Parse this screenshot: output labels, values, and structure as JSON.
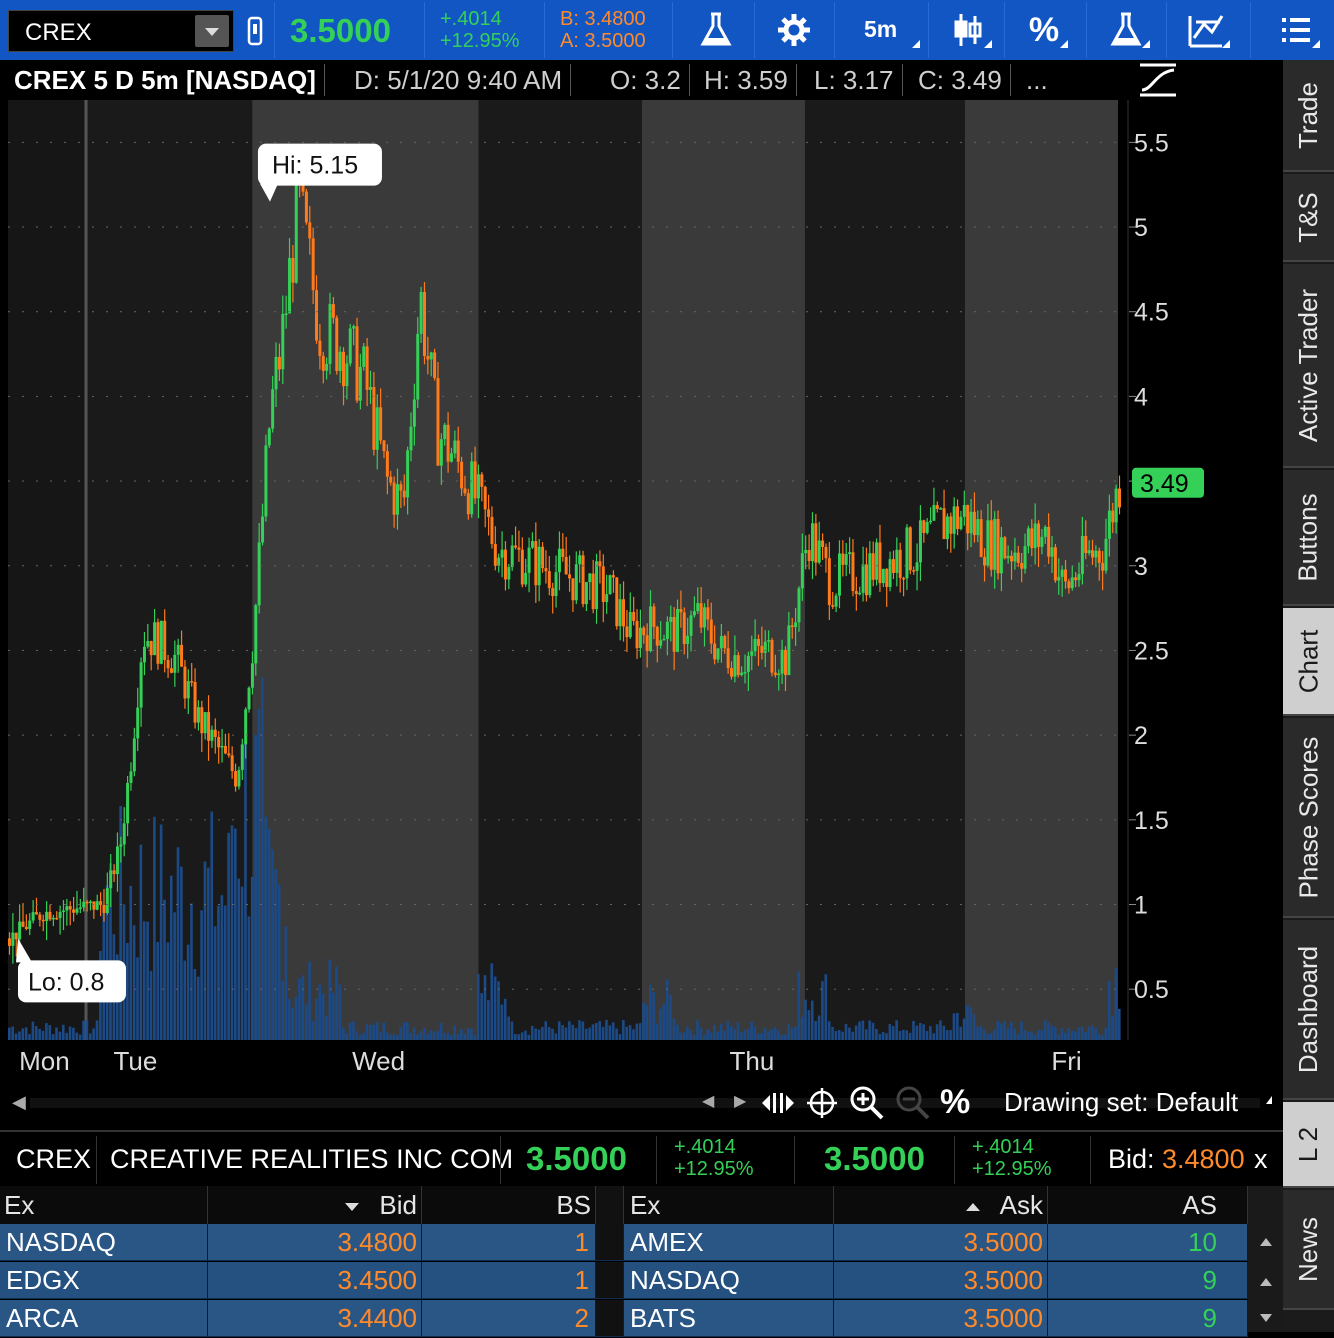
{
  "toolbar": {
    "symbol": "CREX",
    "last": "3.5000",
    "net_change": "+.4014",
    "pct_change": "+12.95%",
    "bid": "B: 3.4800",
    "ask": "A: 3.5000",
    "timeframe": "5m",
    "percent_glyph": "%"
  },
  "chart_header": {
    "title": "CREX 5 D 5m [NASDAQ]",
    "date": "D: 5/1/20 9:40 AM",
    "open": "O: 3.2",
    "high": "H: 3.59",
    "low": "L: 3.17",
    "close": "C: 3.49",
    "more": "..."
  },
  "chart_data": {
    "type": "candlestick",
    "symbol": "CREX",
    "period": "5 D",
    "interval": "5m",
    "ylim": [
      0.2,
      5.75
    ],
    "y_ticks": [
      "0.5",
      "1",
      "1.5",
      "2",
      "2.5",
      "3",
      "3.5",
      "4",
      "4.5",
      "5",
      "5.5"
    ],
    "x_labels": [
      "Mon",
      "Tue",
      "Wed",
      "Thu",
      "Fri"
    ],
    "current_price_label": "3.49",
    "hi_callout": "Hi: 5.15",
    "lo_callout": "Lo: 0.8",
    "hi": 5.15,
    "lo": 0.8,
    "price_path": [
      [
        0.01,
        0.85
      ],
      [
        0.03,
        0.95
      ],
      [
        0.06,
        0.98
      ],
      [
        0.085,
        1.0
      ],
      [
        0.1,
        1.35
      ],
      [
        0.11,
        1.9
      ],
      [
        0.12,
        2.6
      ],
      [
        0.135,
        2.55
      ],
      [
        0.15,
        2.45
      ],
      [
        0.17,
        2.1
      ],
      [
        0.19,
        1.9
      ],
      [
        0.205,
        1.75
      ],
      [
        0.22,
        2.6
      ],
      [
        0.235,
        3.9
      ],
      [
        0.245,
        4.3
      ],
      [
        0.26,
        5.15
      ],
      [
        0.28,
        4.4
      ],
      [
        0.3,
        4.3
      ],
      [
        0.32,
        4.1
      ],
      [
        0.34,
        3.5
      ],
      [
        0.355,
        3.35
      ],
      [
        0.37,
        4.6
      ],
      [
        0.385,
        3.8
      ],
      [
        0.4,
        3.65
      ],
      [
        0.42,
        3.4
      ],
      [
        0.44,
        3.1
      ],
      [
        0.46,
        3.05
      ],
      [
        0.48,
        3.0
      ],
      [
        0.5,
        2.95
      ],
      [
        0.52,
        2.9
      ],
      [
        0.54,
        2.85
      ],
      [
        0.56,
        2.6
      ],
      [
        0.58,
        2.65
      ],
      [
        0.6,
        2.6
      ],
      [
        0.62,
        2.7
      ],
      [
        0.64,
        2.5
      ],
      [
        0.66,
        2.45
      ],
      [
        0.68,
        2.5
      ],
      [
        0.7,
        2.45
      ],
      [
        0.72,
        3.2
      ],
      [
        0.74,
        2.9
      ],
      [
        0.76,
        2.95
      ],
      [
        0.78,
        3.0
      ],
      [
        0.8,
        3.05
      ],
      [
        0.82,
        3.1
      ],
      [
        0.84,
        3.25
      ],
      [
        0.86,
        3.3
      ],
      [
        0.88,
        3.15
      ],
      [
        0.9,
        3.1
      ],
      [
        0.92,
        3.12
      ],
      [
        0.935,
        3.2
      ],
      [
        0.95,
        2.85
      ],
      [
        0.97,
        3.05
      ],
      [
        0.985,
        3.1
      ],
      [
        1.0,
        3.5
      ]
    ]
  },
  "chart_footer": {
    "drawing_set": "Drawing set: Default",
    "percent": "%"
  },
  "right_tabs": [
    "Trade",
    "T&S",
    "Active Trader",
    "Buttons",
    "Chart",
    "Phase Scores",
    "Dashboard",
    "L 2",
    "News"
  ],
  "l2": {
    "symbol": "CREX",
    "name": "CREATIVE REALITIES INC COM",
    "last1": "3.5000",
    "chg1": "+.4014",
    "pct1": "+12.95%",
    "last2": "3.5000",
    "chg2": "+.4014",
    "pct2": "+12.95%",
    "bid_label": "Bid:",
    "bid_value": "3.4800",
    "bid_x": "x",
    "columns": {
      "ex": "Ex",
      "bid": "Bid",
      "bs": "BS",
      "ex2": "Ex",
      "ask": "Ask",
      "as": "AS"
    },
    "bids": [
      {
        "ex": "NASDAQ",
        "price": "3.4800",
        "size": "1"
      },
      {
        "ex": "EDGX",
        "price": "3.4500",
        "size": "1"
      },
      {
        "ex": "ARCA",
        "price": "3.4400",
        "size": "2"
      }
    ],
    "asks": [
      {
        "ex": "AMEX",
        "price": "3.5000",
        "size": "10"
      },
      {
        "ex": "NASDAQ",
        "price": "3.5000",
        "size": "9"
      },
      {
        "ex": "BATS",
        "price": "3.5000",
        "size": "9"
      }
    ]
  },
  "colors": {
    "up": "#34d058",
    "down": "#ff7a1a",
    "toolbar": "#1256c4",
    "volume": "#1c4a86"
  }
}
